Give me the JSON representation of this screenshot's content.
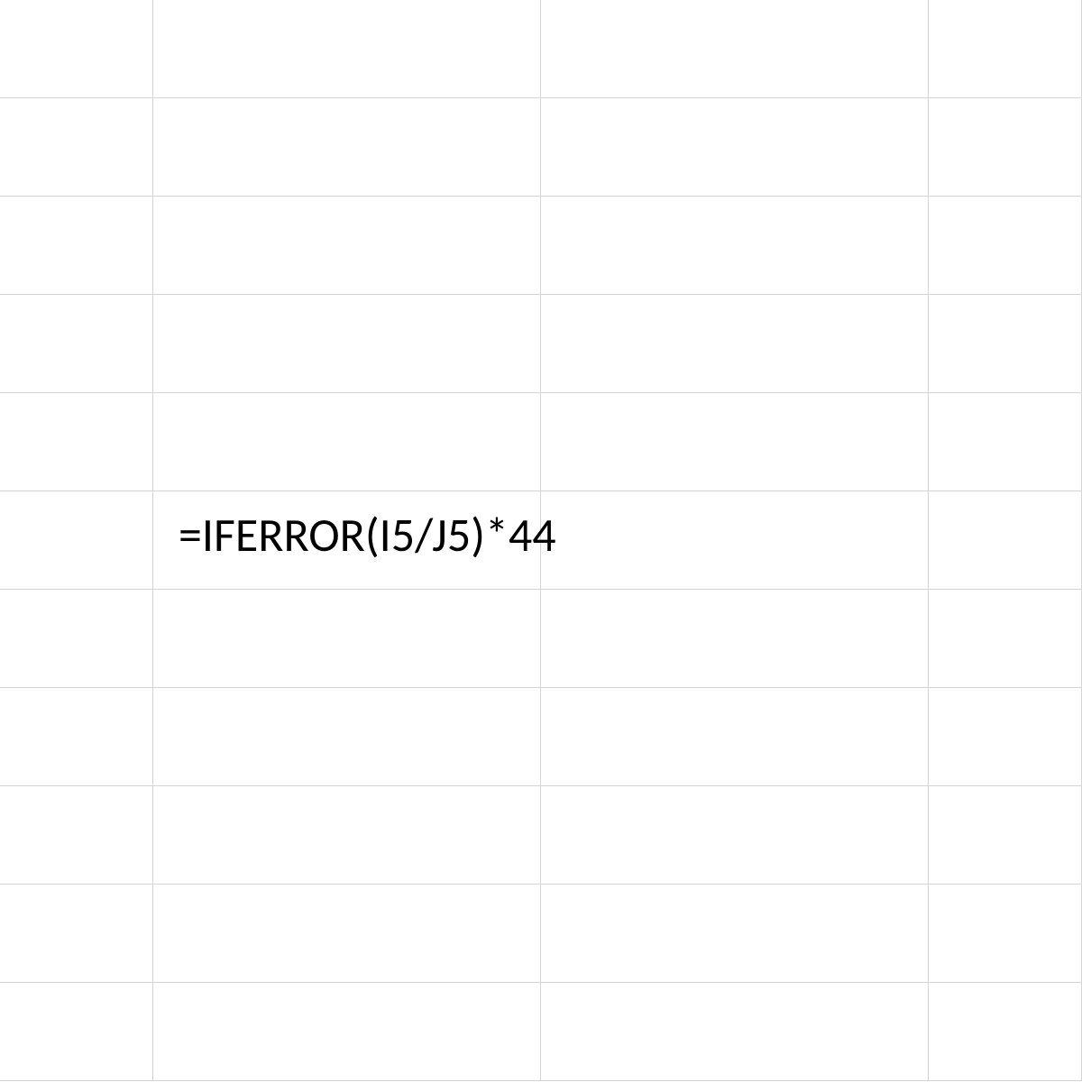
{
  "spreadsheet": {
    "formula_cell_value": "=IFERROR(I5/J5)*44"
  }
}
